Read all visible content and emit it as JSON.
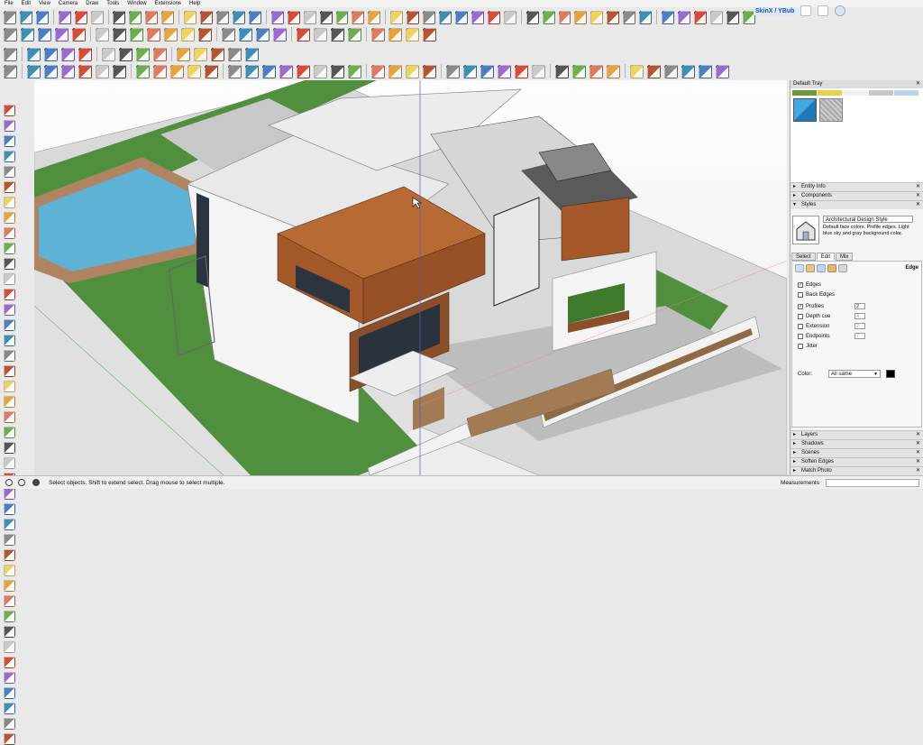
{
  "menu": [
    "File",
    "Edit",
    "View",
    "Camera",
    "Draw",
    "Tools",
    "Window",
    "Extensions",
    "Help"
  ],
  "extension_label": "SkinX / YBub",
  "tray": {
    "title": "Default Tray",
    "close": "✕",
    "sections_top": [
      "Entity Info",
      "Components"
    ],
    "styles_section": "Styles",
    "style_name": "Architectural Design Style",
    "style_description": "Default face colors. Profile edges. Light blue sky and gray background color.",
    "tabs": [
      "Select",
      "Edit",
      "Mix"
    ],
    "edit_heading": "Edge",
    "options": [
      {
        "label": "Edges",
        "checked": true,
        "value": ""
      },
      {
        "label": "Back Edges",
        "checked": false,
        "value": ""
      },
      {
        "label": "Profiles",
        "checked": true,
        "value": "2"
      },
      {
        "label": "Depth cue",
        "checked": false,
        "value": "4"
      },
      {
        "label": "Extension",
        "checked": false,
        "value": "2"
      },
      {
        "label": "Endpoints",
        "checked": false,
        "value": "7"
      },
      {
        "label": "Jitter",
        "checked": false,
        "value": ""
      }
    ],
    "color_label": "Color:",
    "color_value": "All same",
    "edge_color": "#000000",
    "sections_bottom": [
      "Layers",
      "Shadows",
      "Scenes",
      "Soften Edges",
      "Match Photo"
    ]
  },
  "status": {
    "text": "Select objects. Shift to extend select. Drag mouse to select multiple.",
    "measurements_label": "Measurements",
    "measurements_value": ""
  },
  "colors": {
    "wood": "#a5582a",
    "grass": "#4f8f3e",
    "water": "#5db2d6",
    "sky_swatch": "#41a9e0",
    "accent": "#1e58b4"
  }
}
